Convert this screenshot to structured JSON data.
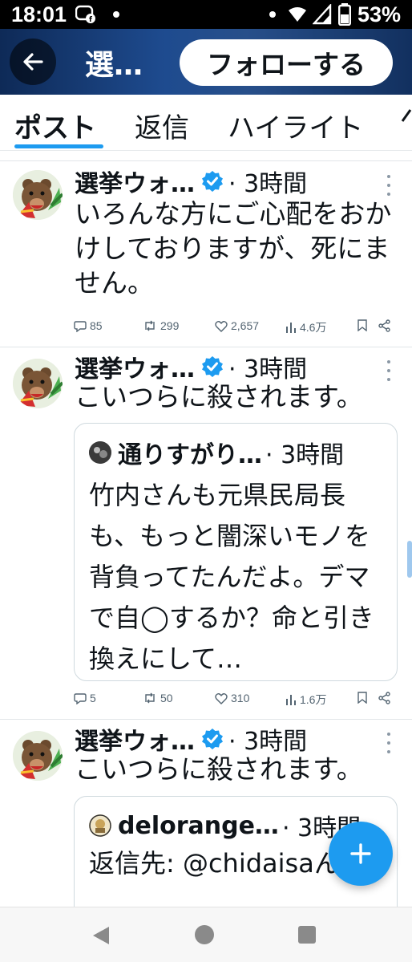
{
  "status_bar": {
    "time": "18:01",
    "battery": "53%"
  },
  "header": {
    "title": "選…",
    "follow_label": "フォローする"
  },
  "tabs": [
    "ポスト",
    "返信",
    "ハイライト"
  ],
  "posts": [
    {
      "author": "選挙ウォ…",
      "time": "· 3時間",
      "text": "いろんな方にご心配をおかけしておりますが、死にません。",
      "replies": "85",
      "reposts": "299",
      "likes": "2,657",
      "views": "4.6万"
    },
    {
      "author": "選挙ウォ…",
      "time": "· 3時間",
      "text": "こいつらに殺されます。",
      "quote": {
        "author": "通りすがり…",
        "time": "· 3時間",
        "text": "竹内さんも元県民局長も、もっと闇深いモノを背負ってたんだよ。デマで自◯するか？命と引き換えにして…"
      },
      "replies": "5",
      "reposts": "50",
      "likes": "310",
      "views": "1.6万"
    },
    {
      "author": "選挙ウォ…",
      "time": "· 3時間",
      "text": "こいつらに殺されます。",
      "quote": {
        "author": "delorange…",
        "time": "· 3時間",
        "text": "返信先: @chidaisaん"
      }
    }
  ],
  "icons": {
    "back": "arrow-left-icon",
    "verified": "verified-badge-icon",
    "more": "more-vertical-icon",
    "reply": "reply-bubble-icon",
    "repost": "repost-icon",
    "like": "heart-icon",
    "views": "bar-chart-icon",
    "bookmark": "bookmark-icon",
    "share": "share-icon",
    "compose": "plus-icon"
  },
  "colors": {
    "accent": "#1d9bf0",
    "text": "#0f1419",
    "muted": "#536471"
  }
}
